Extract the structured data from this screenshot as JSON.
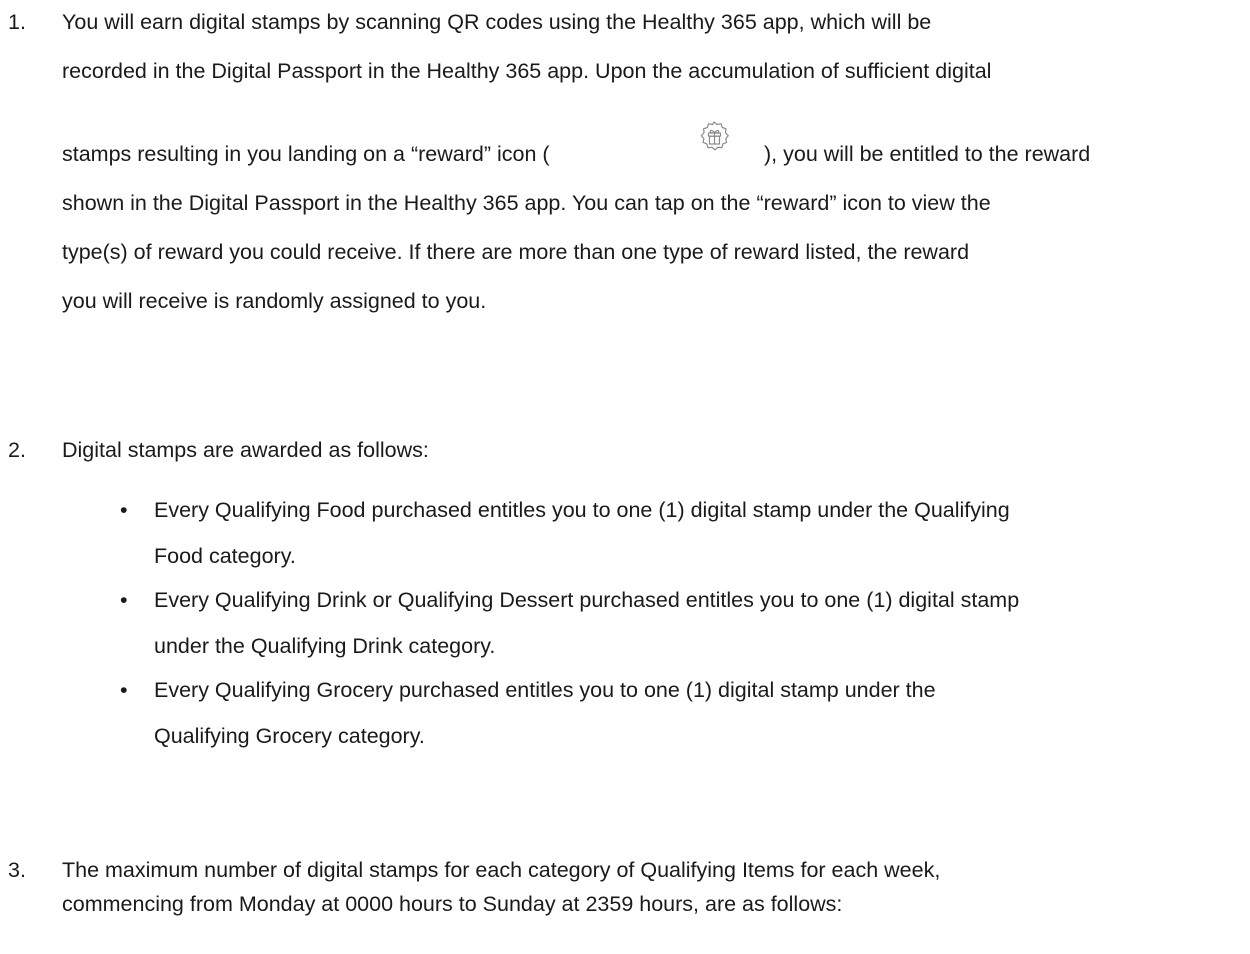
{
  "section1": {
    "number": "1.",
    "line1": "You will earn digital stamps by scanning QR codes using the Healthy 365 app, which will be",
    "line2": "recorded in the Digital Passport in the Healthy 365 app. Upon the accumulation of sufficient digital",
    "line3_before_icon": "stamps resulting in you landing on a “reward” icon (",
    "reward_icon": "gift-badge-icon",
    "line3_after_icon": "), you will be entitled to the reward",
    "line4": "shown in the Digital Passport in the Healthy 365 app. You can tap on the “reward” icon to view the",
    "line5": "type(s) of reward you could receive. If there are more than one type of reward listed, the reward",
    "line6": "you will receive is randomly assigned to you."
  },
  "section2": {
    "number": "2.",
    "intro": "Digital stamps are awarded as follows:",
    "bullets": [
      {
        "marker": "•",
        "line1": "Every Qualifying Food purchased entitles you to one (1) digital stamp under the Qualifying",
        "line2": "Food category."
      },
      {
        "marker": "•",
        "line1": "Every Qualifying Drink or Qualifying Dessert purchased entitles you to one (1) digital stamp",
        "line2": "under the Qualifying Drink category."
      },
      {
        "marker": "•",
        "line1": "Every Qualifying Grocery purchased entitles you to one (1) digital stamp under the",
        "line2": "Qualifying Grocery category."
      }
    ]
  },
  "section3": {
    "number": "3.",
    "line1": "The maximum number of digital stamps for each category of Qualifying Items for each week,",
    "line2": "commencing from Monday at 0000 hours to Sunday at 2359 hours, are as follows:"
  },
  "colors": {
    "text": "#1a1a1a",
    "icon_stroke": "#8a8a8a"
  }
}
